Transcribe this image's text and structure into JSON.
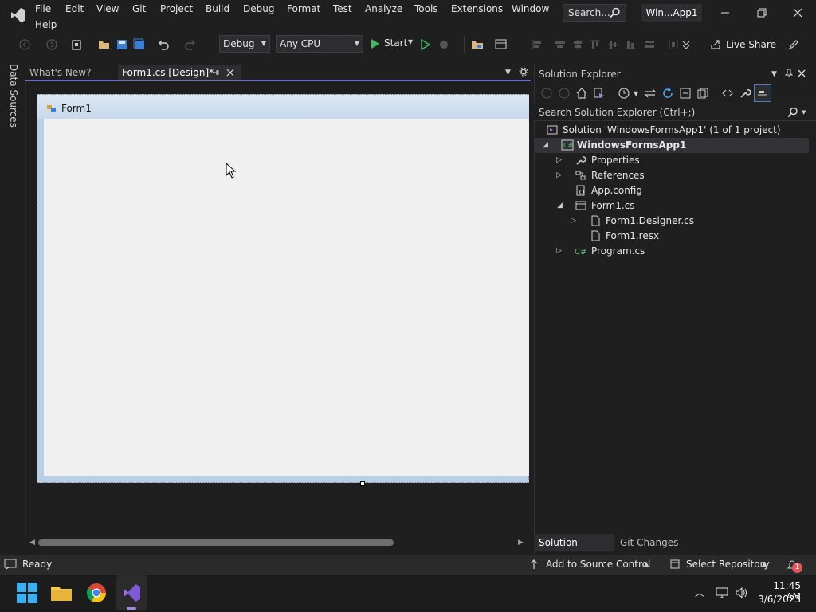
{
  "app": {
    "title_badge": "Win...App1",
    "search_placeholder": "Search..."
  },
  "menu": {
    "items": [
      "File",
      "Edit",
      "View",
      "Git",
      "Project",
      "Build",
      "Debug",
      "Format",
      "Test",
      "Analyze",
      "Tools",
      "Extensions",
      "Window",
      "Help"
    ]
  },
  "toolbar": {
    "config": "Debug",
    "platform": "Any CPU",
    "start_label": "Start",
    "live_share": "Live Share"
  },
  "left_strip": {
    "data_sources": "Data Sources"
  },
  "tabs": {
    "whats_new": "What's New?",
    "form1_design": "Form1.cs [Design]*"
  },
  "designer": {
    "form_title": "Form1"
  },
  "solution_explorer": {
    "title": "Solution Explorer",
    "search_placeholder": "Search Solution Explorer (Ctrl+;)",
    "tree": {
      "solution": "Solution 'WindowsFormsApp1' (1 of 1 project)",
      "project": "WindowsFormsApp1",
      "properties": "Properties",
      "references": "References",
      "app_config": "App.config",
      "form1_cs": "Form1.cs",
      "form1_designer": "Form1.Designer.cs",
      "form1_resx": "Form1.resx",
      "program_cs": "Program.cs"
    },
    "bottom_tabs": [
      "Solution Explorer",
      "Git Changes"
    ]
  },
  "status": {
    "ready": "Ready",
    "add_source_control": "Add to Source Control",
    "select_repository": "Select Repository",
    "notifications": "1"
  },
  "taskbar": {
    "time": "11:45 AM",
    "date": "3/6/2023"
  },
  "colors": {
    "accent": "#6b6bd6",
    "vs_purple": "#7f5ad6",
    "start_green": "#3fbf5f"
  }
}
